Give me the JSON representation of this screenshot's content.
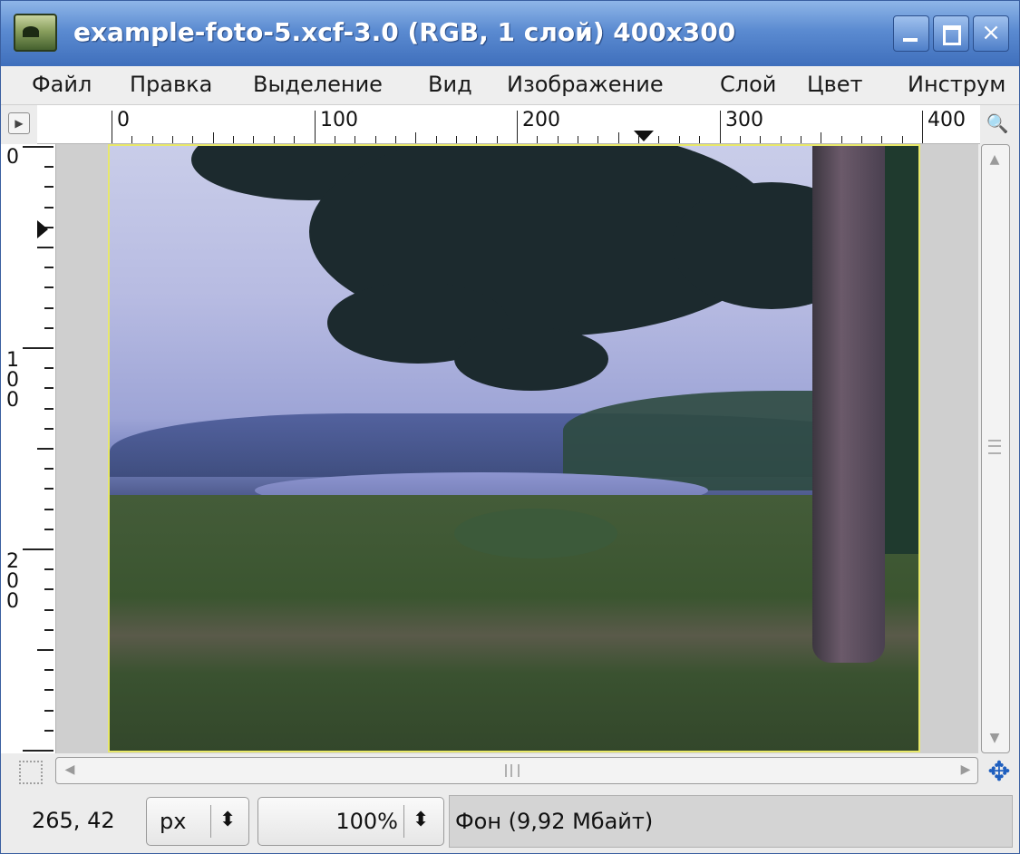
{
  "window": {
    "title": "example-foto-5.xcf-3.0 (RGB, 1 слой) 400x300",
    "controls": {
      "minimize": "minimize",
      "maximize": "maximize",
      "close": "×"
    }
  },
  "menubar": {
    "items": [
      "Файл",
      "Правка",
      "Выделение",
      "Вид",
      "Изображение",
      "Слой",
      "Цвет",
      "Инструм"
    ]
  },
  "rulers": {
    "horizontal_labels": [
      "0",
      "100",
      "200",
      "300",
      "400"
    ],
    "vertical_labels": [
      "0",
      "1",
      "0",
      "0",
      "2",
      "0",
      "0"
    ]
  },
  "canvas": {
    "image_description_icon": "photo-image"
  },
  "statusbar": {
    "pointer_coords": "265, 42",
    "unit": "px",
    "zoom": "100%",
    "layer_info": "Фон (9,92 Мбайт)"
  },
  "icons": {
    "menu_arrow": "▶",
    "zoom": "🔍",
    "navigate": "✥",
    "updown": "⬍",
    "scroll_up": "▲",
    "scroll_down": "▼",
    "scroll_left": "◀",
    "scroll_right": "▶"
  }
}
